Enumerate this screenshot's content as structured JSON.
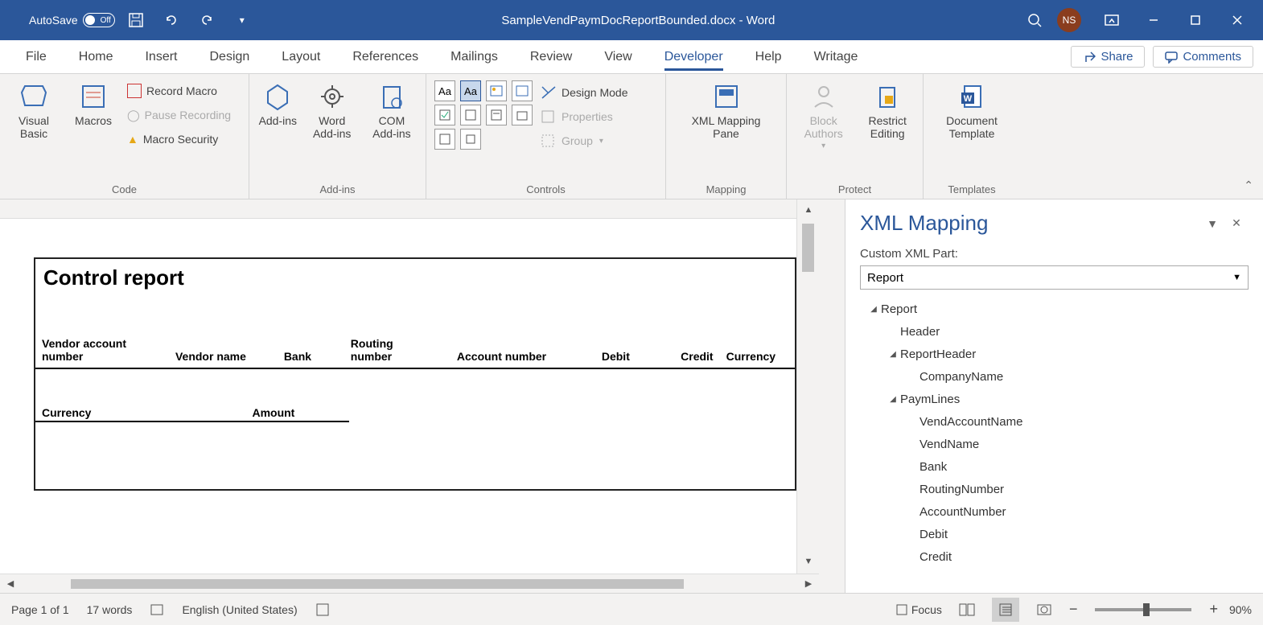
{
  "titlebar": {
    "autosave_label": "AutoSave",
    "autosave_state": "Off",
    "filename": "SampleVendPaymDocReportBounded.docx - Word",
    "user_initials": "NS"
  },
  "tabs": {
    "items": [
      "File",
      "Home",
      "Insert",
      "Design",
      "Layout",
      "References",
      "Mailings",
      "Review",
      "View",
      "Developer",
      "Help",
      "Writage"
    ],
    "active": "Developer",
    "share": "Share",
    "comments": "Comments"
  },
  "ribbon": {
    "code": {
      "label": "Code",
      "visual_basic": "Visual Basic",
      "macros": "Macros",
      "record": "Record Macro",
      "pause": "Pause Recording",
      "security": "Macro Security"
    },
    "addins": {
      "label": "Add-ins",
      "addins": "Add-ins",
      "word_addins": "Word Add-ins",
      "com_addins": "COM Add-ins"
    },
    "controls": {
      "label": "Controls",
      "design_mode": "Design Mode",
      "properties": "Properties",
      "group": "Group"
    },
    "mapping": {
      "label": "Mapping",
      "xml": "XML Mapping Pane"
    },
    "protect": {
      "label": "Protect",
      "block": "Block Authors",
      "restrict": "Restrict Editing"
    },
    "templates": {
      "label": "Templates",
      "doc": "Document Template"
    }
  },
  "document": {
    "title": "Control report",
    "cols": [
      "Vendor account number",
      "Vendor name",
      "Bank",
      "Routing number",
      "Account number",
      "Debit",
      "Credit",
      "Currency"
    ],
    "sub_currency": "Currency",
    "sub_amount": "Amount"
  },
  "xmlpane": {
    "title": "XML Mapping",
    "label": "Custom XML Part:",
    "selected": "Report",
    "tree": {
      "root": "Report",
      "n1": "Header",
      "n2": "ReportHeader",
      "n2a": "CompanyName",
      "n3": "PaymLines",
      "n3a": "VendAccountName",
      "n3b": "VendName",
      "n3c": "Bank",
      "n3d": "RoutingNumber",
      "n3e": "AccountNumber",
      "n3f": "Debit",
      "n3g": "Credit"
    }
  },
  "status": {
    "page": "Page 1 of 1",
    "words": "17 words",
    "lang": "English (United States)",
    "focus": "Focus",
    "zoom": "90%"
  }
}
